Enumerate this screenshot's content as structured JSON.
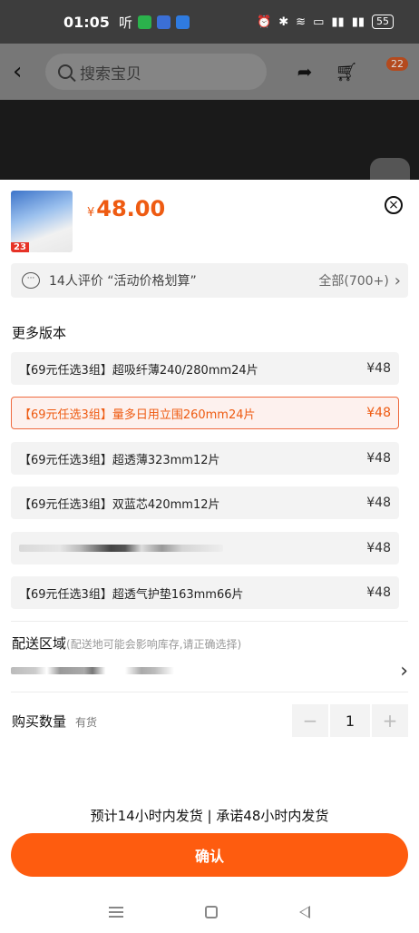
{
  "status": {
    "time": "01:05",
    "app_mark": "听",
    "battery": "55"
  },
  "header": {
    "search_placeholder": "搜索宝贝",
    "cart_badge": "22",
    "icons": [
      "back-icon",
      "search-icon",
      "share-icon",
      "cart-icon",
      "message-icon"
    ]
  },
  "product": {
    "currency": "¥",
    "price": "48.00",
    "thumb_badge": "23"
  },
  "review": {
    "text": "14人评价 “活动价格划算”",
    "all_label": "全部(700+)"
  },
  "variants": {
    "title": "更多版本",
    "items": [
      {
        "label": "【69元任选3组】超吸纤薄240/280mm24片",
        "price": "¥48"
      },
      {
        "label": "【69元任选3组】量多日用立围260mm24片",
        "price": "¥48",
        "selected": true
      },
      {
        "label": "【69元任选3组】超透薄323mm12片",
        "price": "¥48"
      },
      {
        "label": "【69元任选3组】双蓝芯420mm12片",
        "price": "¥48"
      },
      {
        "label": "",
        "price": "¥48",
        "obscured": true
      },
      {
        "label": "【69元任选3组】超透气护垫163mm66片",
        "price": "¥48"
      }
    ]
  },
  "delivery": {
    "title": "配送区域",
    "hint": "(配送地可能会影响库存,请正确选择)"
  },
  "quantity": {
    "label": "购买数量",
    "stock": "有货",
    "value": "1",
    "minus": "−",
    "plus": "+"
  },
  "shipping_note": "预计14小时内发货 | 承诺48小时内发货",
  "confirm_label": "确认",
  "colors": {
    "accent": "#fe5c0f",
    "price": "#ee5b12"
  }
}
